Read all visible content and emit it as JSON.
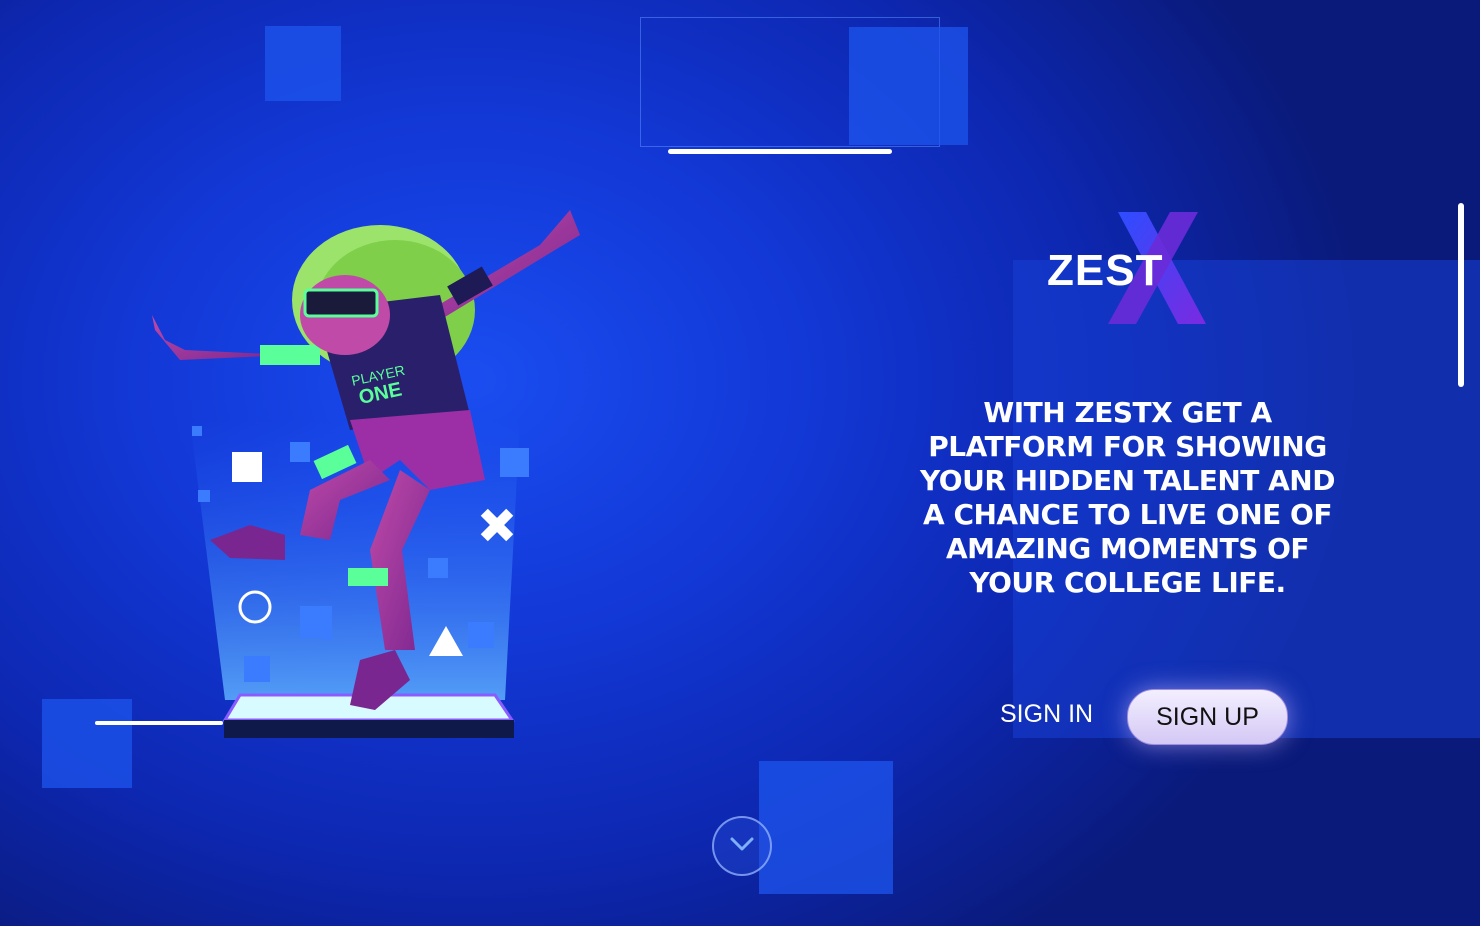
{
  "brand": {
    "logo_text": "ZEST",
    "logo_accent": "X",
    "accent_color": "#7a2ae0",
    "accent_color_2": "#2d4dff"
  },
  "hero": {
    "tagline": "WITH ZESTX GET A PLATFORM FOR SHOWING YOUR HIDDEN TALENT AND A CHANCE TO LIVE ONE OF AMAZING MOMENTS OF YOUR COLLEGE LIFE.",
    "illustration_shirt_line1": "PLAYER",
    "illustration_shirt_line2": "ONE"
  },
  "actions": {
    "sign_in_label": "SIGN IN",
    "sign_up_label": "SIGN UP"
  },
  "icons": {
    "scroll_down": "chevron-down-icon"
  },
  "colors": {
    "background": "#1339d8",
    "button_bg": "#e8e2fb",
    "text": "#ffffff"
  }
}
